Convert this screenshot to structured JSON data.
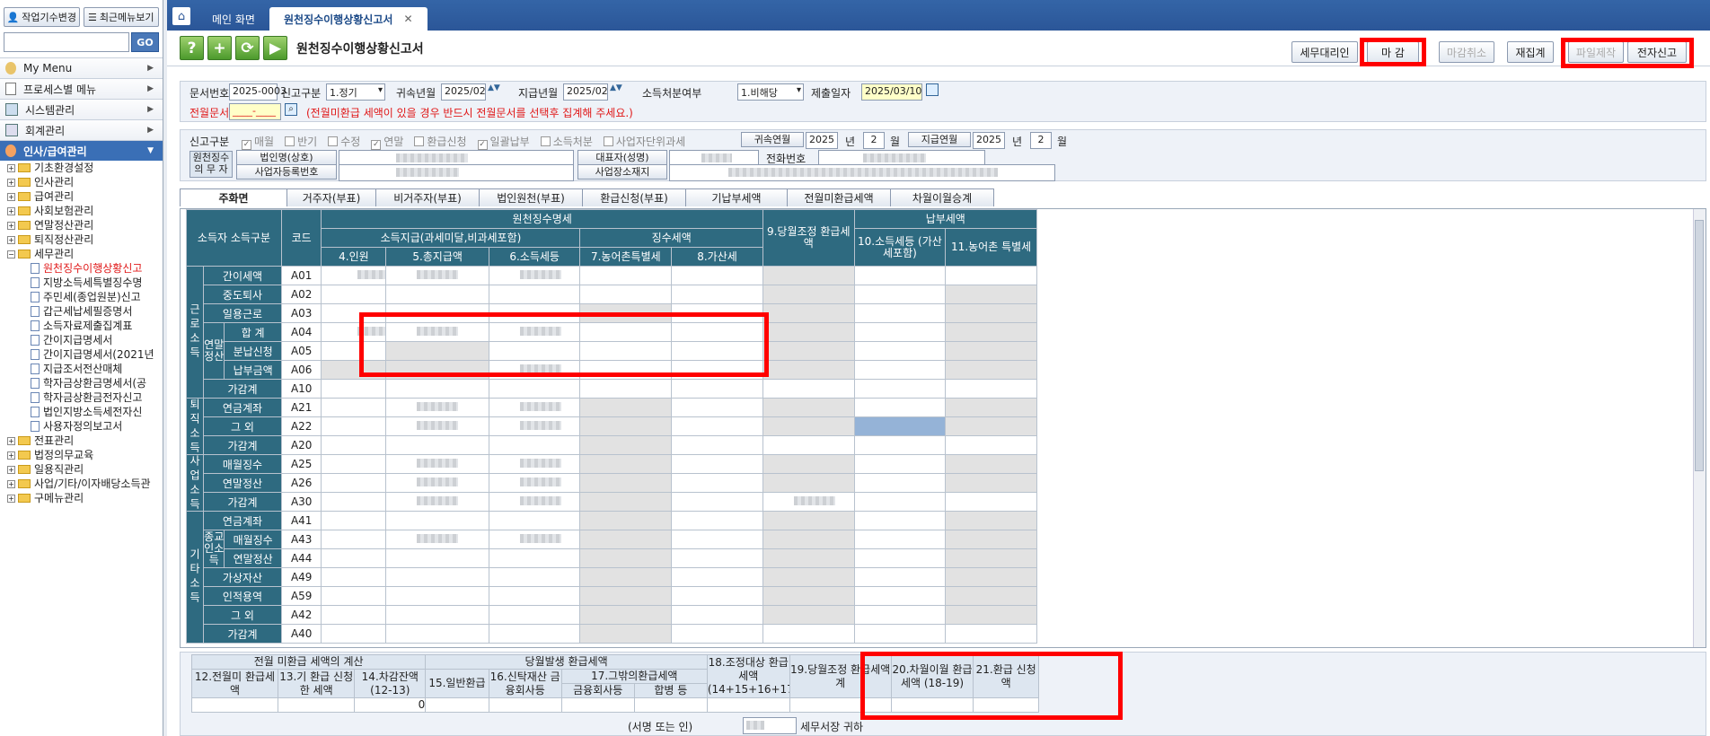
{
  "sidebar": {
    "work_change": "작업기수변경",
    "recent_menu": "최근메뉴보기",
    "go": "GO",
    "menus": [
      {
        "label": "My Menu"
      },
      {
        "label": "프로세스별 메뉴"
      },
      {
        "label": "시스템관리"
      },
      {
        "label": "회계관리"
      },
      {
        "label": "인사/급여관리"
      }
    ],
    "tree": [
      {
        "label": "기초환경설정",
        "type": "folder"
      },
      {
        "label": "인사관리",
        "type": "folder"
      },
      {
        "label": "급여관리",
        "type": "folder"
      },
      {
        "label": "사회보험관리",
        "type": "folder"
      },
      {
        "label": "연말정산관리",
        "type": "folder"
      },
      {
        "label": "퇴직정산관리",
        "type": "folder"
      },
      {
        "label": "세무관리",
        "type": "folder-open"
      },
      {
        "label": "원천징수이행상황신고",
        "type": "doc",
        "selected": true
      },
      {
        "label": "지방소득세특별징수명",
        "type": "doc"
      },
      {
        "label": "주민세(종업원분)신고",
        "type": "doc"
      },
      {
        "label": "갑근세납세필증명서",
        "type": "doc"
      },
      {
        "label": "소득자료제출집계표",
        "type": "doc"
      },
      {
        "label": "간이지급명세서",
        "type": "doc"
      },
      {
        "label": "간이지급명세서(2021년",
        "type": "doc"
      },
      {
        "label": "지급조서전산매체",
        "type": "doc"
      },
      {
        "label": "학자금상환금명세서(공",
        "type": "doc"
      },
      {
        "label": "학자금상환금전자신고",
        "type": "doc"
      },
      {
        "label": "법인지방소득세전자신",
        "type": "doc"
      },
      {
        "label": "사용자정의보고서",
        "type": "doc"
      },
      {
        "label": "전표관리",
        "type": "folder"
      },
      {
        "label": "법정의무교육",
        "type": "folder"
      },
      {
        "label": "일용직관리",
        "type": "folder"
      },
      {
        "label": "사업/기타/이자배당소득관",
        "type": "folder"
      },
      {
        "label": "구메뉴관리",
        "type": "folder"
      }
    ]
  },
  "tabs": {
    "home": "메인 화면",
    "active": "원천징수이행상황신고서"
  },
  "toolbar": {
    "title": "원천징수이행상황신고서",
    "btn_tax_agent": "세무대리인",
    "btn_close": "마   감",
    "btn_cancel_close": "마감취소",
    "btn_recalc": "재집계",
    "btn_file_make": "파일제작",
    "btn_e_file": "전자신고"
  },
  "form": {
    "doc_no_label": "문서번호",
    "doc_no": "2025-0003",
    "report_type_label": "신고구분",
    "report_type": "1.정기",
    "attr_month_label": "귀속년월",
    "attr_month": "2025/02",
    "pay_month_label": "지급년월",
    "pay_month": "2025/02",
    "income_treat_label": "소득처분여부",
    "income_treat": "1.비해당",
    "submit_date_label": "제출일자",
    "submit_date": "2025/03/10",
    "prev_doc_label": "전월문서",
    "prev_doc": "____-____",
    "prev_doc_note": "(전월미환급 세액이 있을 경우 반드시 전월문서를 선택후 집계해 주세요.)"
  },
  "report": {
    "label": "신고구분",
    "checks": [
      {
        "label": "매월",
        "checked": true
      },
      {
        "label": "반기",
        "checked": false
      },
      {
        "label": "수정",
        "checked": false
      },
      {
        "label": "연말",
        "checked": true
      },
      {
        "label": "환급신청",
        "checked": false
      },
      {
        "label": "일괄납부",
        "checked": true
      },
      {
        "label": "소득처분",
        "checked": false
      },
      {
        "label": "사업자단위과세",
        "checked": false
      }
    ],
    "attr_ym_label": "귀속연월",
    "attr_year": "2025",
    "year_unit": "년",
    "attr_mon": "2",
    "mon_unit": "월",
    "pay_ym_label": "지급연월",
    "pay_year": "2025",
    "pay_mon": "2",
    "withholder_label": "원천징수의 무 자",
    "corp_name_label": "법인명(상호)",
    "reg_no_label": "사업자등록번호",
    "rep_label": "대표자(성명)",
    "addr_label": "사업장소재지",
    "tel_label": "전화번호"
  },
  "subtabs": [
    "주화면",
    "거주자(부표)",
    "비거주자(부표)",
    "법인원천(부표)",
    "환급신청(부표)",
    "기납부세액",
    "전월미환급세액",
    "차월이월승계"
  ],
  "grid": {
    "h_income": "소득자 소득구분",
    "h_code": "코드",
    "h_wh": "원천징수명세",
    "h_pay": "소득지급(과세미달,비과세포함)",
    "h_collect": "징수세액",
    "h_c4": "4.인원",
    "h_c5": "5.총지급액",
    "h_c6": "6.소득세등",
    "h_c7": "7.농어촌특별세",
    "h_c8": "8.가산세",
    "h_c9": "9.당월조정 환급세액",
    "h_payment": "납부세액",
    "h_c10": "10.소득세등 (가산세포함)",
    "h_c11": "11.농어촌 특별세",
    "g_labor": "근로소득",
    "g_year": "연말정산",
    "g_retire": "퇴직소득",
    "g_biz": "사업소득",
    "g_other": "기타소득",
    "g_rel": "종교인소득",
    "rows": [
      {
        "name": "간이세액",
        "code": "A01"
      },
      {
        "name": "중도퇴사",
        "code": "A02"
      },
      {
        "name": "일용근로",
        "code": "A03"
      },
      {
        "name": "합    계",
        "code": "A04"
      },
      {
        "name": "분납신청",
        "code": "A05"
      },
      {
        "name": "납부금액",
        "code": "A06"
      },
      {
        "name": "가감계",
        "code": "A10"
      },
      {
        "name": "연금계좌",
        "code": "A21"
      },
      {
        "name": "그  외",
        "code": "A22"
      },
      {
        "name": "가감계",
        "code": "A20"
      },
      {
        "name": "매월징수",
        "code": "A25"
      },
      {
        "name": "연말정산",
        "code": "A26"
      },
      {
        "name": "가감계",
        "code": "A30"
      },
      {
        "name": "연금계좌",
        "code": "A41"
      },
      {
        "name": "매월징수",
        "code": "A43"
      },
      {
        "name": "연말정산",
        "code": "A44"
      },
      {
        "name": "가상자산",
        "code": "A49"
      },
      {
        "name": "인적용역",
        "code": "A59"
      },
      {
        "name": "그  외",
        "code": "A42"
      },
      {
        "name": "가감계",
        "code": "A40"
      }
    ]
  },
  "bottom": {
    "h_prev": "전월 미환급 세액의 계산",
    "h_cur": "당월발생 환급세액",
    "c12": "12.전월미 환급세액",
    "c13": "13.기 환급 신청한 세액",
    "c14": "14.차감잔액 (12-13)",
    "c15": "15.일반환급",
    "c16": "16.신탁재산 금융회사등",
    "c17": "17.그밖의환급세액",
    "c17a": "금융회사등",
    "c17b": "합병 등",
    "c18": "18.조정대상 환급세액 (14+15+16+17)",
    "c19": "19.당월조정 환급세액계",
    "c20": "20.차월이월 환급세액 (18-19)",
    "c21": "21.환급 신청액",
    "c14_val": "0",
    "sign": "(서명 또는 인)",
    "tax_office": "세무서장 귀하"
  }
}
